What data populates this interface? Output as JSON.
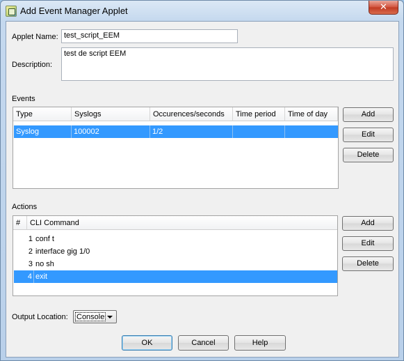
{
  "window": {
    "title": "Add Event Manager Applet",
    "close_glyph": "✕"
  },
  "form": {
    "applet_name_label": "Applet Name:",
    "applet_name_value": "test_script_EEM",
    "description_label": "Description:",
    "description_value": "test de script EEM"
  },
  "events": {
    "section_label": "Events",
    "columns": [
      "Type",
      "Syslogs",
      "Occurences/seconds",
      "Time period",
      "Time of day"
    ],
    "rows": [
      {
        "type": "Syslog",
        "syslogs": "100002",
        "occurences": "1/2",
        "time_period": "",
        "time_of_day": ""
      }
    ],
    "buttons": {
      "add": "Add",
      "edit": "Edit",
      "delete": "Delete"
    }
  },
  "actions": {
    "section_label": "Actions",
    "columns": [
      "#",
      "CLI Command"
    ],
    "rows": [
      {
        "num": "1",
        "command": "conf t"
      },
      {
        "num": "2",
        "command": "interface gig 1/0"
      },
      {
        "num": "3",
        "command": "no sh"
      },
      {
        "num": "4",
        "command": "exit"
      }
    ],
    "selected_row": 4,
    "buttons": {
      "add": "Add",
      "edit": "Edit",
      "delete": "Delete"
    }
  },
  "output": {
    "label": "Output Location:",
    "selected": "Console"
  },
  "footer": {
    "ok": "OK",
    "cancel": "Cancel",
    "help": "Help"
  },
  "colors": {
    "selection": "#3399ff",
    "titlebar": "#c4d8ee",
    "close_button": "#d2523c"
  },
  "icons": {
    "app": "eem-applet-icon",
    "close": "close-icon",
    "dropdown": "chevron-down-icon"
  }
}
